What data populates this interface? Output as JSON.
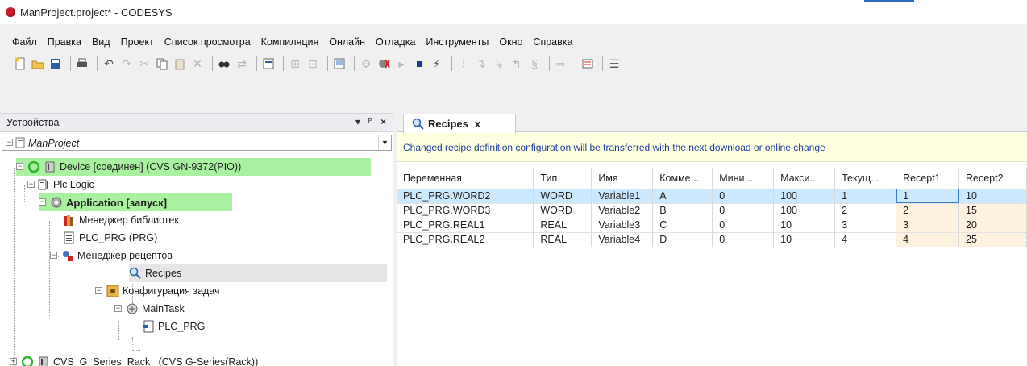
{
  "window": {
    "title": "ManProject.project* - CODESYS"
  },
  "menu": [
    "Файл",
    "Правка",
    "Вид",
    "Проект",
    "Список просмотра",
    "Компиляция",
    "Онлайн",
    "Отладка",
    "Инструменты",
    "Окно",
    "Справка"
  ],
  "toolbar": {
    "icons": [
      "new-project-icon",
      "open-icon",
      "save-icon",
      "print-icon",
      "undo-icon",
      "redo-icon",
      "cut-icon",
      "copy-icon",
      "paste-icon",
      "delete-icon",
      "find-icon",
      "replace-icon",
      "clipboard-icon",
      "add-object-icon",
      "new-pou-icon",
      "monitor-icon",
      "login-icon",
      "logout-icon",
      "run-icon",
      "stop-icon",
      "reset-icon",
      "breakpoint-icon",
      "step-over-icon",
      "step-into-icon",
      "step-out-icon",
      "show-next-icon",
      "write-icon",
      "force-icon",
      "compile-icon"
    ]
  },
  "devices_panel": {
    "title": "Устройства",
    "pin_symbol": "ᴾ",
    "dropdown_symbol": "▾",
    "close_symbol": "×",
    "project_name": "ManProject",
    "tree": [
      {
        "label": "Device [соединен] (CVS GN-9372(PIO))",
        "icon": "device-icon",
        "state": "connected"
      },
      {
        "label": "Plc Logic",
        "icon": "plc-logic-icon"
      },
      {
        "label": "Application [запуск]",
        "icon": "application-icon",
        "state": "running"
      },
      {
        "label": "Менеджер библиотек",
        "icon": "library-manager-icon"
      },
      {
        "label": "PLC_PRG (PRG)",
        "icon": "program-icon"
      },
      {
        "label": "Менеджер рецептов",
        "icon": "recipe-manager-icon"
      },
      {
        "label": "Recipes",
        "icon": "recipes-icon"
      },
      {
        "label": "Конфигурация задач",
        "icon": "task-config-icon"
      },
      {
        "label": "MainTask",
        "icon": "task-icon"
      },
      {
        "label": "PLC_PRG",
        "icon": "pou-call-icon"
      },
      {
        "label": "CVS_G_Series_Rack_ (CVS G-Series(Rack))",
        "icon": "rack-icon"
      }
    ]
  },
  "editor": {
    "tab_label": "Recipes",
    "tab_close": "x",
    "info_message": "Changed recipe definition configuration will be transferred with the next download or online change",
    "columns": [
      "Переменная",
      "Тип",
      "Имя",
      "Комме...",
      "Мини...",
      "Макси...",
      "Текущ...",
      "Recept1",
      "Recept2"
    ],
    "rows": [
      [
        "PLC_PRG.WORD2",
        "WORD",
        "Variable1",
        "A",
        "0",
        "100",
        "1",
        "1",
        "10"
      ],
      [
        "PLC_PRG.WORD3",
        "WORD",
        "Variable2",
        "B",
        "0",
        "100",
        "2",
        "2",
        "15"
      ],
      [
        "PLC_PRG.REAL1",
        "REAL",
        "Variable3",
        "C",
        "0",
        "10",
        "3",
        "3",
        "20"
      ],
      [
        "PLC_PRG.REAL2",
        "REAL",
        "Variable4",
        "D",
        "0",
        "10",
        "4",
        "4",
        "25"
      ]
    ]
  },
  "colors": {
    "connected_highlight": "#a9f0a0",
    "selected_row": "#cce8ff",
    "recipe_cell": "#fdf1e0",
    "info_bg": "#ffffe1",
    "info_text": "#1f3f9e"
  }
}
